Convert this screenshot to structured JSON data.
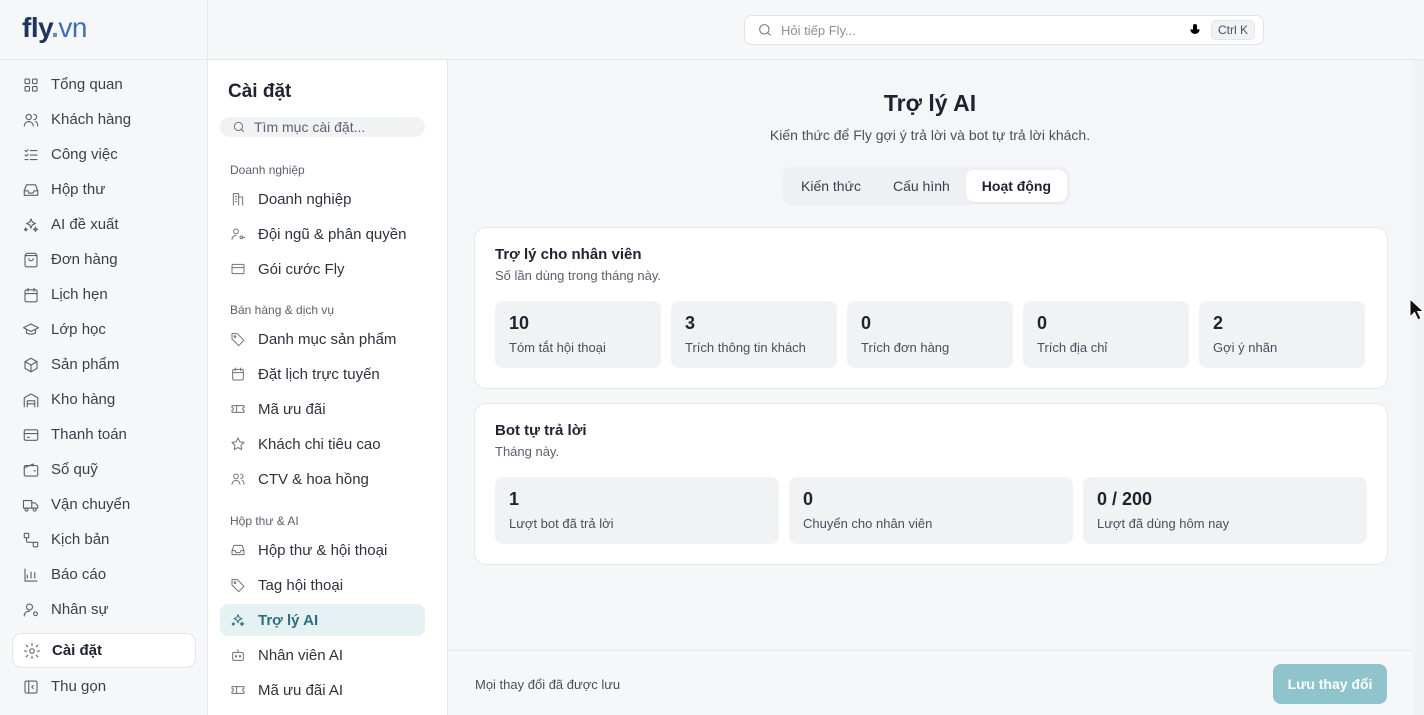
{
  "brand": {
    "fly": "fly",
    "dot": ".",
    "vn": "vn"
  },
  "nav": {
    "items": [
      {
        "label": "Tổng quan",
        "icon": "grid-icon"
      },
      {
        "label": "Khách hàng",
        "icon": "users-icon"
      },
      {
        "label": "Công việc",
        "icon": "tasks-icon"
      },
      {
        "label": "Hộp thư",
        "icon": "inbox-icon"
      },
      {
        "label": "AI đề xuất",
        "icon": "sparkles-icon"
      },
      {
        "label": "Đơn hàng",
        "icon": "bag-icon"
      },
      {
        "label": "Lịch hẹn",
        "icon": "calendar-icon"
      },
      {
        "label": "Lớp học",
        "icon": "graduation-cap-icon"
      },
      {
        "label": "Sản phẩm",
        "icon": "box-icon"
      },
      {
        "label": "Kho hàng",
        "icon": "warehouse-icon"
      },
      {
        "label": "Thanh toán",
        "icon": "credit-card-icon"
      },
      {
        "label": "Sổ quỹ",
        "icon": "wallet-icon"
      },
      {
        "label": "Vận chuyển",
        "icon": "truck-icon"
      },
      {
        "label": "Kịch bản",
        "icon": "workflow-icon"
      },
      {
        "label": "Báo cáo",
        "icon": "bar-chart-icon"
      },
      {
        "label": "Nhân sự",
        "icon": "user-cog-icon"
      }
    ],
    "active": {
      "label": "Cài đặt",
      "icon": "gear-icon"
    },
    "collapse": {
      "label": "Thu gọn",
      "icon": "sidebar-collapse-icon"
    }
  },
  "search": {
    "placeholder": "Hỏi tiếp Fly...",
    "shortcut": "Ctrl K"
  },
  "settings": {
    "title": "Cài đặt",
    "search_placeholder": "Tìm mục cài đặt...",
    "groups": [
      {
        "title": "Doanh nghiệp",
        "items": [
          {
            "label": "Doanh nghiệp",
            "icon": "building-icon"
          },
          {
            "label": "Đội ngũ & phân quyền",
            "icon": "user-key-icon"
          },
          {
            "label": "Gói cước Fly",
            "icon": "card-icon"
          }
        ]
      },
      {
        "title": "Bán hàng & dịch vụ",
        "items": [
          {
            "label": "Danh mục sản phẩm",
            "icon": "tag-icon"
          },
          {
            "label": "Đặt lịch trực tuyến",
            "icon": "calendar-icon"
          },
          {
            "label": "Mã ưu đãi",
            "icon": "ticket-icon"
          },
          {
            "label": "Khách chi tiêu cao",
            "icon": "star-icon"
          },
          {
            "label": "CTV & hoa hồng",
            "icon": "users-icon"
          }
        ]
      },
      {
        "title": "Hộp thư & AI",
        "items": [
          {
            "label": "Hộp thư & hội thoại",
            "icon": "inbox-icon"
          },
          {
            "label": "Tag hội thoại",
            "icon": "tag-icon"
          },
          {
            "label": "Trợ lý AI",
            "icon": "sparkles-icon",
            "active": true
          },
          {
            "label": "Nhân viên AI",
            "icon": "bot-icon"
          },
          {
            "label": "Mã ưu đãi AI",
            "icon": "ticket-icon"
          }
        ]
      }
    ]
  },
  "main": {
    "title": "Trợ lý AI",
    "subtitle": "Kiến thức để Fly gợi ý trả lời và bot tự trả lời khách.",
    "tabs": [
      {
        "label": "Kiến thức",
        "active": false
      },
      {
        "label": "Cấu hình",
        "active": false
      },
      {
        "label": "Hoạt động",
        "active": true
      }
    ],
    "staff_card": {
      "title": "Trợ lý cho nhân viên",
      "subtitle": "Số lần dùng trong tháng này.",
      "stats": [
        {
          "value": "10",
          "label": "Tóm tắt hội thoại"
        },
        {
          "value": "3",
          "label": "Trích thông tin khách"
        },
        {
          "value": "0",
          "label": "Trích đơn hàng"
        },
        {
          "value": "0",
          "label": "Trích địa chỉ"
        },
        {
          "value": "2",
          "label": "Gợi ý nhãn"
        }
      ]
    },
    "bot_card": {
      "title": "Bot tự trả lời",
      "subtitle": "Tháng này.",
      "stats": [
        {
          "value": "1",
          "label": "Lượt bot đã trả lời"
        },
        {
          "value": "0",
          "label": "Chuyển cho nhân viên"
        },
        {
          "value": "0 / 200",
          "label": "Lượt đã dùng hôm nay"
        }
      ]
    },
    "footer": {
      "message": "Mọi thay đổi đã được lưu",
      "save_label": "Lưu thay đổi"
    }
  },
  "colors": {
    "accent": "#2b6f80",
    "active_bg": "#e6f1f3",
    "save_button": "#8fc4cc",
    "brand": "#20355e"
  }
}
